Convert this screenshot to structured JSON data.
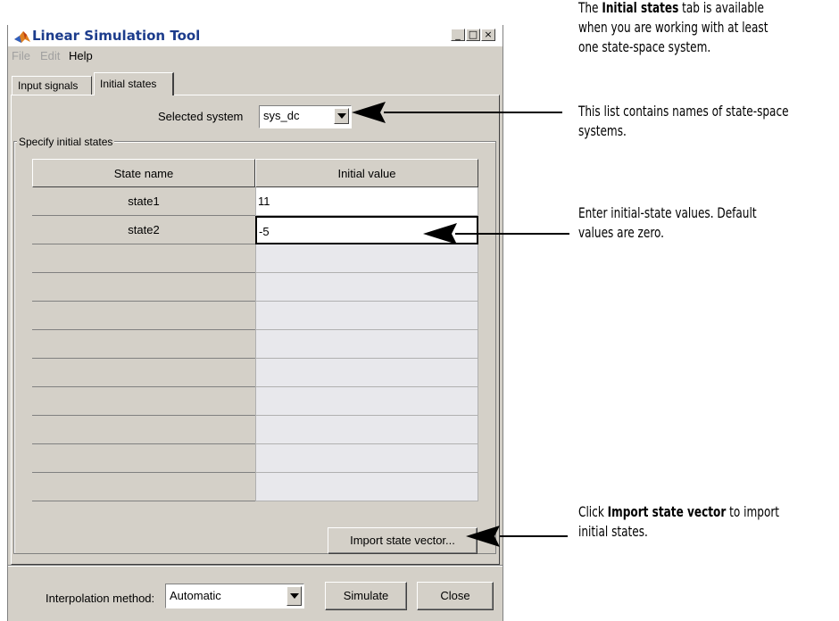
{
  "window": {
    "title": "Linear Simulation Tool",
    "controls": [
      "_",
      "□",
      "×"
    ]
  },
  "menu": {
    "items": [
      "File",
      "Edit",
      "Help"
    ]
  },
  "tabs": [
    "Input signals",
    "Initial states"
  ],
  "selected_system": {
    "label": "Selected system",
    "value": "sys_dc"
  },
  "group": {
    "label": "Specify initial states"
  },
  "table": {
    "headers": [
      "State name",
      "Initial value"
    ],
    "rows": [
      {
        "name": "state1",
        "value": "11"
      },
      {
        "name": "state2",
        "value": "-5"
      }
    ]
  },
  "buttons": {
    "import": "Import state vector...",
    "simulate": "Simulate",
    "close": "Close"
  },
  "interpolation": {
    "label": "Interpolation method:",
    "value": "Automatic"
  },
  "annotations": {
    "a1_line1_pre": "The ",
    "a1_line1_bold": "Initial states",
    "a1_line1_post": " tab is available",
    "a1_line2": "when you are working with at least",
    "a1_line3": "one state-space system.",
    "a2_line1": "This list contains names of state-space",
    "a2_line2": "systems.",
    "a3_line1": "Enter initial-state values. Default",
    "a3_line2": "values are zero.",
    "a4_line1_pre": "Click ",
    "a4_line1_bold": "Import state vector",
    "a4_line1_post": " to import",
    "a4_line2": "initial states."
  },
  "colors": {
    "window_bg": "#d4d0c8",
    "title_text": "#1c3c8c",
    "empty_cell": "#e8e8ec"
  }
}
